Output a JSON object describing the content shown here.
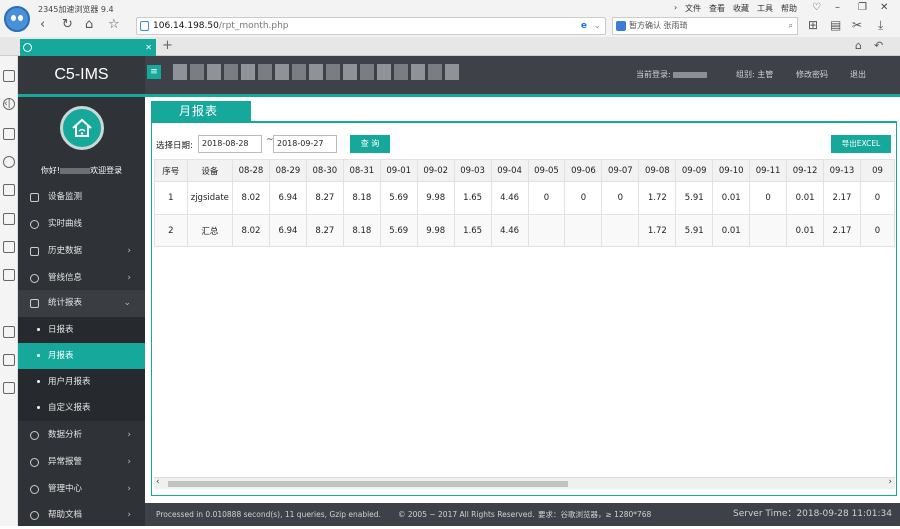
{
  "browser": {
    "title": "2345加速浏览器 9.4",
    "menu": [
      "文件",
      "查看",
      "收藏",
      "工具",
      "帮助"
    ],
    "address": {
      "host": "106.14.198.50",
      "path": "/rpt_month.php"
    },
    "search_text": "暂方确认 张雨琦",
    "tab_label": "",
    "colors": {
      "accent": "#16a89a",
      "header": "#3e4147",
      "sidebar": "#2f3237"
    }
  },
  "app": {
    "brand": "C5-IMS",
    "header": {
      "current_login_label": "当前登录:",
      "group": "组别: 主管",
      "change_password": "修改密码",
      "logout": "退出"
    },
    "sidebar": {
      "welcome_prefix": "你好!",
      "welcome_suffix": "欢迎登录",
      "items": [
        {
          "label": "设备监测",
          "icon": "layers-icon",
          "chevron": false
        },
        {
          "label": "实时曲线",
          "icon": "curve-icon",
          "chevron": false
        },
        {
          "label": "历史数据",
          "icon": "history-icon",
          "chevron": true
        },
        {
          "label": "管线信息",
          "icon": "pipeline-icon",
          "chevron": true
        },
        {
          "label": "统计报表",
          "icon": "report-icon",
          "chevron": true,
          "open": true
        },
        {
          "label": "数据分析",
          "icon": "analysis-icon",
          "chevron": true
        },
        {
          "label": "异常报警",
          "icon": "alarm-icon",
          "chevron": true
        },
        {
          "label": "管理中心",
          "icon": "settings-icon",
          "chevron": true
        },
        {
          "label": "帮助文档",
          "icon": "help-icon",
          "chevron": true
        }
      ],
      "sub_items": [
        {
          "label": "日报表",
          "active": false
        },
        {
          "label": "月报表",
          "active": true
        },
        {
          "label": "用户月报表",
          "active": false
        },
        {
          "label": "自定义报表",
          "active": false
        }
      ]
    },
    "panel": {
      "title": "月报表",
      "date_label": "选择日期:",
      "date_from": "2018-08-28",
      "tilde": "~",
      "date_to": "2018-09-27",
      "query_button": "查 询",
      "export_button": "导出EXCEL"
    },
    "table": {
      "headers": [
        "序号",
        "设备",
        "08-28",
        "08-29",
        "08-30",
        "08-31",
        "09-01",
        "09-02",
        "09-03",
        "09-04",
        "09-05",
        "09-06",
        "09-07",
        "09-08",
        "09-09",
        "09-10",
        "09-11",
        "09-12",
        "09-13",
        "09"
      ],
      "rows": [
        [
          "1",
          "zjgsidate",
          "8.02",
          "6.94",
          "8.27",
          "8.18",
          "5.69",
          "9.98",
          "1.65",
          "4.46",
          "0",
          "0",
          "0",
          "1.72",
          "5.91",
          "0.01",
          "0",
          "0.01",
          "2.17",
          "0"
        ],
        [
          "2",
          "汇总",
          "8.02",
          "6.94",
          "8.27",
          "8.18",
          "5.69",
          "9.98",
          "1.65",
          "4.46",
          "",
          "",
          "",
          "1.72",
          "5.91",
          "0.01",
          "",
          "0.01",
          "2.17",
          "0"
        ]
      ]
    },
    "footer": {
      "processed": "Processed in 0.010888 second(s), 11 queries, Gzip enabled.",
      "copyright": "© 2005 ~ 2017 All Rights Reserved.",
      "requirement": "要求：谷歌浏览器，≥ 1280*768",
      "server_time": "Server Time：2018-09-28 11:01:34"
    }
  }
}
